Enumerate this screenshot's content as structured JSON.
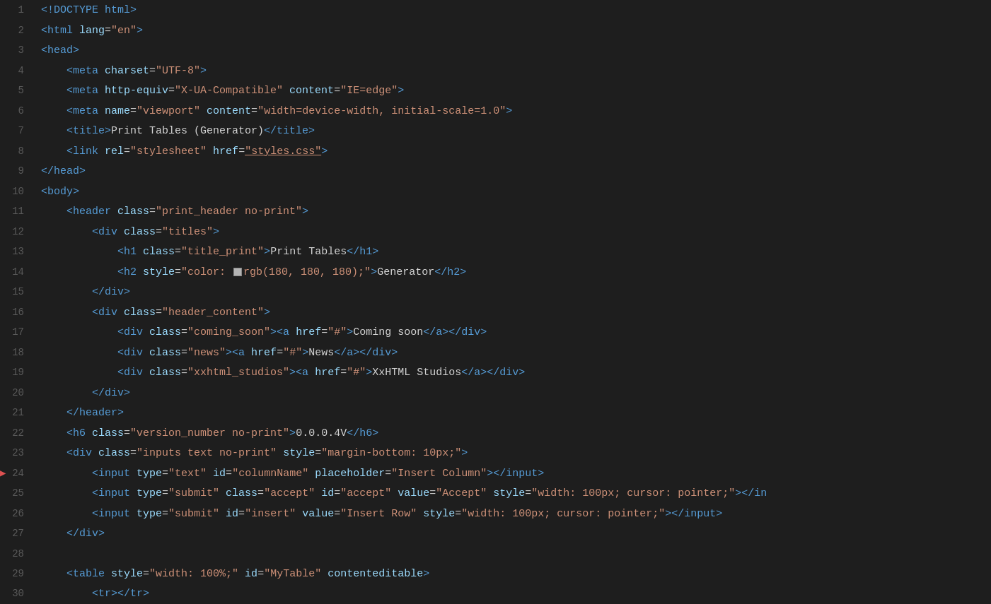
{
  "editor": {
    "background": "#1e1e1e",
    "lines": [
      {
        "number": 1,
        "active": false,
        "tokens": [
          {
            "type": "tag",
            "text": "<!DOCTYPE html>"
          }
        ]
      },
      {
        "number": 2,
        "active": false,
        "tokens": [
          {
            "type": "tag",
            "text": "<html "
          },
          {
            "type": "attr-name",
            "text": "lang"
          },
          {
            "type": "plain",
            "text": "="
          },
          {
            "type": "string",
            "text": "\"en\""
          },
          {
            "type": "tag",
            "text": ">"
          }
        ]
      },
      {
        "number": 3,
        "active": false,
        "tokens": [
          {
            "type": "tag",
            "text": "<head>"
          }
        ]
      },
      {
        "number": 4,
        "active": false,
        "indent": 1,
        "tokens": [
          {
            "type": "tag",
            "text": "<meta "
          },
          {
            "type": "attr-name",
            "text": "charset"
          },
          {
            "type": "plain",
            "text": "="
          },
          {
            "type": "string",
            "text": "\"UTF-8\""
          },
          {
            "type": "tag",
            "text": ">"
          }
        ]
      },
      {
        "number": 5,
        "active": false,
        "indent": 1,
        "tokens": [
          {
            "type": "tag",
            "text": "<meta "
          },
          {
            "type": "attr-name",
            "text": "http-equiv"
          },
          {
            "type": "plain",
            "text": "="
          },
          {
            "type": "string",
            "text": "\"X-UA-Compatible\""
          },
          {
            "type": "plain",
            "text": " "
          },
          {
            "type": "attr-name",
            "text": "content"
          },
          {
            "type": "plain",
            "text": "="
          },
          {
            "type": "string",
            "text": "\"IE=edge\""
          },
          {
            "type": "tag",
            "text": ">"
          }
        ]
      },
      {
        "number": 6,
        "active": false,
        "indent": 1,
        "tokens": [
          {
            "type": "tag",
            "text": "<meta "
          },
          {
            "type": "attr-name",
            "text": "name"
          },
          {
            "type": "plain",
            "text": "="
          },
          {
            "type": "string",
            "text": "\"viewport\""
          },
          {
            "type": "plain",
            "text": " "
          },
          {
            "type": "attr-name",
            "text": "content"
          },
          {
            "type": "plain",
            "text": "="
          },
          {
            "type": "string",
            "text": "\"width=device-width, initial-scale=1.0\""
          },
          {
            "type": "tag",
            "text": ">"
          }
        ]
      },
      {
        "number": 7,
        "active": false,
        "indent": 1,
        "tokens": [
          {
            "type": "tag",
            "text": "<title>"
          },
          {
            "type": "plain",
            "text": "Print Tables (Generator)"
          },
          {
            "type": "tag",
            "text": "</title>"
          }
        ]
      },
      {
        "number": 8,
        "active": false,
        "indent": 1,
        "tokens": [
          {
            "type": "tag",
            "text": "<link "
          },
          {
            "type": "attr-name",
            "text": "rel"
          },
          {
            "type": "plain",
            "text": "="
          },
          {
            "type": "string",
            "text": "\"stylesheet\""
          },
          {
            "type": "plain",
            "text": " "
          },
          {
            "type": "attr-name",
            "text": "href"
          },
          {
            "type": "plain",
            "text": "="
          },
          {
            "type": "string-underline",
            "text": "\"styles.css\""
          },
          {
            "type": "tag",
            "text": ">"
          }
        ]
      },
      {
        "number": 9,
        "active": false,
        "tokens": [
          {
            "type": "tag",
            "text": "</head>"
          }
        ]
      },
      {
        "number": 10,
        "active": false,
        "tokens": [
          {
            "type": "tag",
            "text": "<body>"
          }
        ]
      },
      {
        "number": 11,
        "active": false,
        "indent": 1,
        "tokens": [
          {
            "type": "tag",
            "text": "<header "
          },
          {
            "type": "attr-name",
            "text": "class"
          },
          {
            "type": "plain",
            "text": "="
          },
          {
            "type": "string",
            "text": "\"print_header no-print\""
          },
          {
            "type": "tag",
            "text": ">"
          }
        ]
      },
      {
        "number": 12,
        "active": false,
        "indent": 2,
        "tokens": [
          {
            "type": "tag",
            "text": "<div "
          },
          {
            "type": "attr-name",
            "text": "class"
          },
          {
            "type": "plain",
            "text": "="
          },
          {
            "type": "string",
            "text": "\"titles\""
          },
          {
            "type": "tag",
            "text": ">"
          }
        ]
      },
      {
        "number": 13,
        "active": false,
        "indent": 3,
        "tokens": [
          {
            "type": "tag",
            "text": "<h1 "
          },
          {
            "type": "attr-name",
            "text": "class"
          },
          {
            "type": "plain",
            "text": "="
          },
          {
            "type": "string",
            "text": "\"title_print\""
          },
          {
            "type": "tag",
            "text": ">"
          },
          {
            "type": "plain",
            "text": "Print Tables"
          },
          {
            "type": "tag",
            "text": "</h1>"
          }
        ]
      },
      {
        "number": 14,
        "active": false,
        "indent": 3,
        "tokens": [
          {
            "type": "tag",
            "text": "<h2 "
          },
          {
            "type": "attr-name",
            "text": "style"
          },
          {
            "type": "plain",
            "text": "="
          },
          {
            "type": "string",
            "text": "\"color: "
          },
          {
            "type": "swatch",
            "text": ""
          },
          {
            "type": "string",
            "text": "rgb(180, 180, 180);\""
          },
          {
            "type": "tag",
            "text": ">"
          },
          {
            "type": "plain",
            "text": "Generator"
          },
          {
            "type": "tag",
            "text": "</h2>"
          }
        ]
      },
      {
        "number": 15,
        "active": false,
        "indent": 2,
        "tokens": [
          {
            "type": "tag",
            "text": "</div>"
          }
        ]
      },
      {
        "number": 16,
        "active": false,
        "indent": 2,
        "tokens": [
          {
            "type": "tag",
            "text": "<div "
          },
          {
            "type": "attr-name",
            "text": "class"
          },
          {
            "type": "plain",
            "text": "="
          },
          {
            "type": "string",
            "text": "\"header_content\""
          },
          {
            "type": "tag",
            "text": ">"
          }
        ]
      },
      {
        "number": 17,
        "active": false,
        "indent": 3,
        "tokens": [
          {
            "type": "tag",
            "text": "<div "
          },
          {
            "type": "attr-name",
            "text": "class"
          },
          {
            "type": "plain",
            "text": "="
          },
          {
            "type": "string",
            "text": "\"coming_soon\""
          },
          {
            "type": "tag",
            "text": "><a "
          },
          {
            "type": "attr-name",
            "text": "href"
          },
          {
            "type": "plain",
            "text": "="
          },
          {
            "type": "string",
            "text": "\"#\""
          },
          {
            "type": "tag",
            "text": ">"
          },
          {
            "type": "plain",
            "text": "Coming soon"
          },
          {
            "type": "tag",
            "text": "</a></div>"
          }
        ]
      },
      {
        "number": 18,
        "active": false,
        "indent": 3,
        "tokens": [
          {
            "type": "tag",
            "text": "<div "
          },
          {
            "type": "attr-name",
            "text": "class"
          },
          {
            "type": "plain",
            "text": "="
          },
          {
            "type": "string",
            "text": "\"news\""
          },
          {
            "type": "tag",
            "text": "><a "
          },
          {
            "type": "attr-name",
            "text": "href"
          },
          {
            "type": "plain",
            "text": "="
          },
          {
            "type": "string",
            "text": "\"#\""
          },
          {
            "type": "tag",
            "text": ">"
          },
          {
            "type": "plain",
            "text": "News"
          },
          {
            "type": "tag",
            "text": "</a></div>"
          }
        ]
      },
      {
        "number": 19,
        "active": false,
        "indent": 3,
        "tokens": [
          {
            "type": "tag",
            "text": "<div "
          },
          {
            "type": "attr-name",
            "text": "class"
          },
          {
            "type": "plain",
            "text": "="
          },
          {
            "type": "string",
            "text": "\"xxhtml_studios\""
          },
          {
            "type": "tag",
            "text": "><a "
          },
          {
            "type": "attr-name",
            "text": "href"
          },
          {
            "type": "plain",
            "text": "="
          },
          {
            "type": "string",
            "text": "\"#\""
          },
          {
            "type": "tag",
            "text": ">"
          },
          {
            "type": "plain",
            "text": "XxHTML Studios"
          },
          {
            "type": "tag",
            "text": "</a></div>"
          }
        ]
      },
      {
        "number": 20,
        "active": false,
        "indent": 2,
        "tokens": [
          {
            "type": "tag",
            "text": "</div>"
          }
        ]
      },
      {
        "number": 21,
        "active": false,
        "indent": 1,
        "tokens": [
          {
            "type": "tag",
            "text": "</header>"
          }
        ]
      },
      {
        "number": 22,
        "active": false,
        "indent": 1,
        "tokens": [
          {
            "type": "tag",
            "text": "<h6 "
          },
          {
            "type": "attr-name",
            "text": "class"
          },
          {
            "type": "plain",
            "text": "="
          },
          {
            "type": "string",
            "text": "\"version_number no-print\""
          },
          {
            "type": "tag",
            "text": ">"
          },
          {
            "type": "plain",
            "text": "0.0.0.4V"
          },
          {
            "type": "tag",
            "text": "</h6>"
          }
        ]
      },
      {
        "number": 23,
        "active": false,
        "indent": 1,
        "tokens": [
          {
            "type": "tag",
            "text": "<div "
          },
          {
            "type": "attr-name",
            "text": "class"
          },
          {
            "type": "plain",
            "text": "="
          },
          {
            "type": "string",
            "text": "\"inputs text no-print\""
          },
          {
            "type": "plain",
            "text": " "
          },
          {
            "type": "attr-name",
            "text": "style"
          },
          {
            "type": "plain",
            "text": "="
          },
          {
            "type": "string",
            "text": "\"margin-bottom: 10px;\""
          },
          {
            "type": "tag",
            "text": ">"
          }
        ]
      },
      {
        "number": 24,
        "active": false,
        "indent": 2,
        "has_arrow": false,
        "tokens": [
          {
            "type": "tag",
            "text": "<input "
          },
          {
            "type": "attr-name",
            "text": "type"
          },
          {
            "type": "plain",
            "text": "="
          },
          {
            "type": "string",
            "text": "\"text\""
          },
          {
            "type": "plain",
            "text": " "
          },
          {
            "type": "attr-name",
            "text": "id"
          },
          {
            "type": "plain",
            "text": "="
          },
          {
            "type": "string",
            "text": "\"columnName\""
          },
          {
            "type": "plain",
            "text": " "
          },
          {
            "type": "attr-name",
            "text": "placeholder"
          },
          {
            "type": "plain",
            "text": "="
          },
          {
            "type": "string",
            "text": "\"Insert Column\""
          },
          {
            "type": "tag",
            "text": "></input>"
          }
        ]
      },
      {
        "number": 25,
        "active": false,
        "indent": 2,
        "tokens": [
          {
            "type": "tag",
            "text": "<input "
          },
          {
            "type": "attr-name",
            "text": "type"
          },
          {
            "type": "plain",
            "text": "="
          },
          {
            "type": "string",
            "text": "\"submit\""
          },
          {
            "type": "plain",
            "text": " "
          },
          {
            "type": "attr-name",
            "text": "class"
          },
          {
            "type": "plain",
            "text": "="
          },
          {
            "type": "string",
            "text": "\"accept\""
          },
          {
            "type": "plain",
            "text": " "
          },
          {
            "type": "attr-name",
            "text": "id"
          },
          {
            "type": "plain",
            "text": "="
          },
          {
            "type": "string",
            "text": "\"accept\""
          },
          {
            "type": "plain",
            "text": " "
          },
          {
            "type": "attr-name",
            "text": "value"
          },
          {
            "type": "plain",
            "text": "="
          },
          {
            "type": "string",
            "text": "\"Accept\""
          },
          {
            "type": "plain",
            "text": " "
          },
          {
            "type": "attr-name",
            "text": "style"
          },
          {
            "type": "plain",
            "text": "="
          },
          {
            "type": "string",
            "text": "\"width: 100px; cursor: pointer;\""
          },
          {
            "type": "tag",
            "text": "></in"
          }
        ]
      },
      {
        "number": 26,
        "active": false,
        "indent": 2,
        "tokens": [
          {
            "type": "tag",
            "text": "<input "
          },
          {
            "type": "attr-name",
            "text": "type"
          },
          {
            "type": "plain",
            "text": "="
          },
          {
            "type": "string",
            "text": "\"submit\""
          },
          {
            "type": "plain",
            "text": " "
          },
          {
            "type": "attr-name",
            "text": "id"
          },
          {
            "type": "plain",
            "text": "="
          },
          {
            "type": "string",
            "text": "\"insert\""
          },
          {
            "type": "plain",
            "text": " "
          },
          {
            "type": "attr-name",
            "text": "value"
          },
          {
            "type": "plain",
            "text": "="
          },
          {
            "type": "string",
            "text": "\"Insert Row\""
          },
          {
            "type": "plain",
            "text": " "
          },
          {
            "type": "attr-name",
            "text": "style"
          },
          {
            "type": "plain",
            "text": "="
          },
          {
            "type": "string",
            "text": "\"width: 100px; cursor: pointer;\""
          },
          {
            "type": "tag",
            "text": "></input>"
          }
        ]
      },
      {
        "number": 27,
        "active": false,
        "indent": 1,
        "tokens": [
          {
            "type": "tag",
            "text": "</div>"
          }
        ]
      },
      {
        "number": 28,
        "active": false,
        "tokens": []
      },
      {
        "number": 29,
        "active": false,
        "indent": 1,
        "tokens": [
          {
            "type": "tag",
            "text": "<table "
          },
          {
            "type": "attr-name",
            "text": "style"
          },
          {
            "type": "plain",
            "text": "="
          },
          {
            "type": "string",
            "text": "\"width: 100%;\""
          },
          {
            "type": "plain",
            "text": " "
          },
          {
            "type": "attr-name",
            "text": "id"
          },
          {
            "type": "plain",
            "text": "="
          },
          {
            "type": "string",
            "text": "\"MyTable\""
          },
          {
            "type": "plain",
            "text": " "
          },
          {
            "type": "attr-name",
            "text": "contenteditable"
          },
          {
            "type": "tag",
            "text": ">"
          }
        ]
      },
      {
        "number": 30,
        "active": false,
        "indent": 2,
        "tokens": [
          {
            "type": "tag",
            "text": "<tr></tr>"
          }
        ]
      }
    ]
  }
}
